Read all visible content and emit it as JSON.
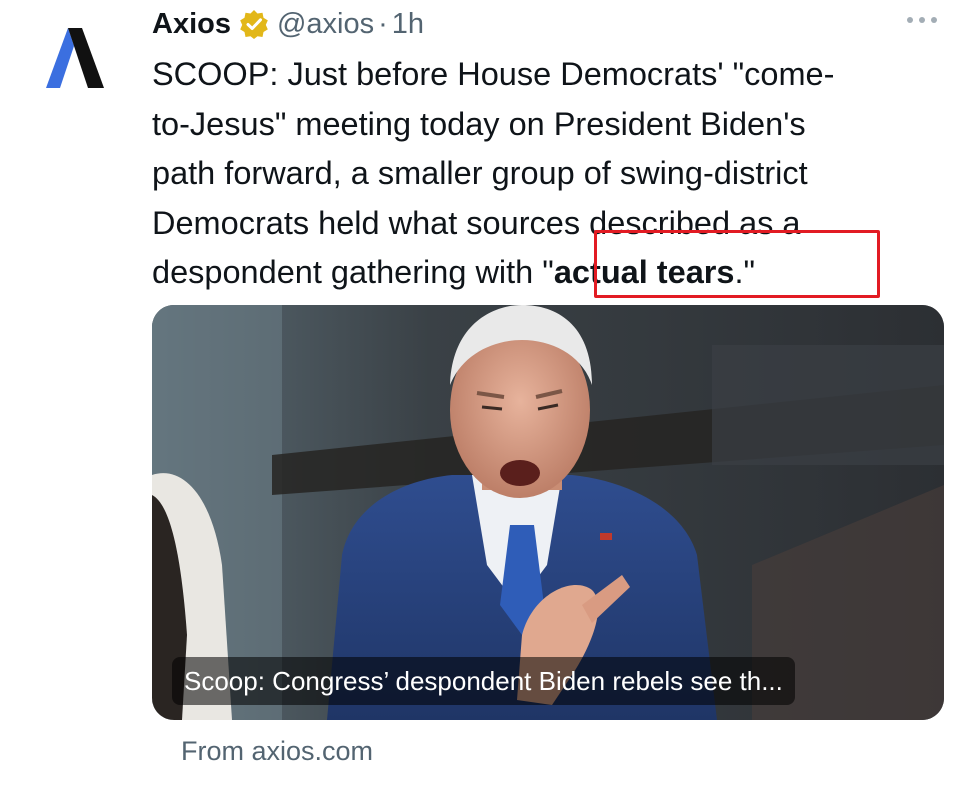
{
  "tweet": {
    "author_name": "Axios",
    "author_handle": "@axios",
    "separator": "·",
    "timestamp": "1h",
    "avatar_icon": "axios-logo-icon",
    "verified_icon": "verified-badge-icon",
    "more_icon": "more-options-icon",
    "text_lines": [
      "SCOOP: Just before House Democrats' \"come-",
      "to-Jesus\" meeting today on President Biden's",
      "path forward, a smaller group of swing-district",
      "Democrats held what sources described as a"
    ],
    "last_line_prefix": "despondent gathering with ",
    "quote_open": "\"",
    "quote_bold": "actual tears",
    "quote_close": ".\""
  },
  "card": {
    "caption": "Scoop: Congress’ despondent Biden rebels see th...",
    "source": "From axios.com"
  },
  "colors": {
    "highlight_border": "#e21b23",
    "verified_gold": "#e2b719",
    "axios_blue": "#3b6fe0",
    "muted_text": "#536471"
  }
}
